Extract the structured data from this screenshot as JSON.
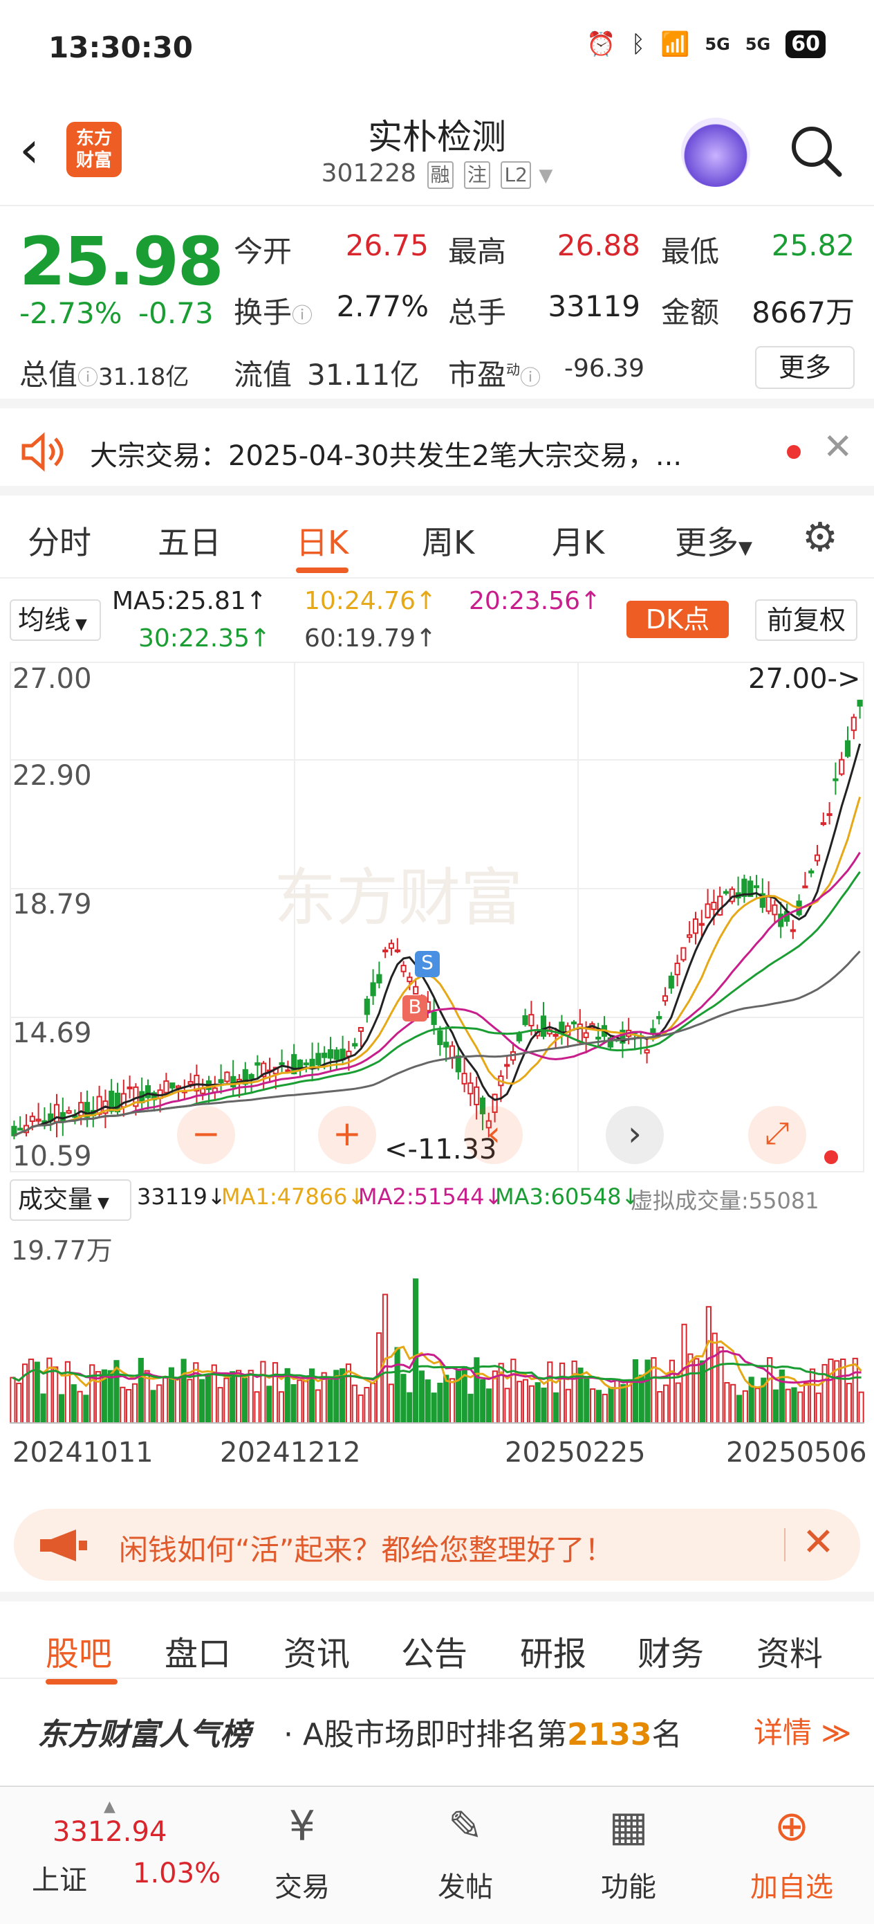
{
  "status": {
    "time": "13:30:30",
    "battery": "60",
    "net1": "5G",
    "net2": "5G"
  },
  "header": {
    "title": "实朴检测",
    "code": "301228",
    "tags": [
      "融",
      "注",
      "L2"
    ],
    "logo": "东方\n财富"
  },
  "quote": {
    "price": "25.98",
    "pct": "-2.73%",
    "chg": "-0.73",
    "open_l": "今开",
    "open_v": "26.75",
    "high_l": "最高",
    "high_v": "26.88",
    "low_l": "最低",
    "low_v": "25.82",
    "turn_l": "换手",
    "turn_v": "2.77%",
    "vol_l": "总手",
    "vol_v": "33119",
    "amt_l": "金额",
    "amt_v": "8667万",
    "cap_l": "总值",
    "cap_v": "31.18亿",
    "fcap_l": "流值",
    "fcap_v": "31.11亿",
    "pe_l": "市盈",
    "pe_v": "-96.39",
    "more": "更多"
  },
  "notice": {
    "text": "大宗交易：2025-04-30共发生2笔大宗交易，..."
  },
  "tabs": [
    "分时",
    "五日",
    "日K",
    "周K",
    "月K",
    "更多"
  ],
  "ma": {
    "sel": "均线",
    "ma5": "MA5:25.81↑",
    "ma10": "10:24.76↑",
    "ma20": "20:23.56↑",
    "ma30": "30:22.35↑",
    "ma60": "60:19.79↑",
    "dk": "DK点",
    "fq": "前复权"
  },
  "chart": {
    "y_labels": [
      "27.00",
      "22.90",
      "18.79",
      "14.69",
      "10.59"
    ],
    "max_label": "27.00->",
    "min_label": "<-11.33"
  },
  "volume": {
    "sel": "成交量",
    "cur": "33119↓",
    "ma1": "MA1:47866↓",
    "ma2": "MA2:51544↓",
    "ma3": "MA3:60548↓",
    "virt": "虚拟成交量:55081",
    "ymax": "19.77万"
  },
  "dates": [
    "20241011",
    "20241212",
    "20250225",
    "20250506"
  ],
  "ad": {
    "text": "闲钱如何“活”起来？都给您整理好了！"
  },
  "subtabs": [
    "股吧",
    "盘口",
    "资讯",
    "公告",
    "研报",
    "财务",
    "资料"
  ],
  "rank": {
    "brand": "东方财富人气榜",
    "text": "· A股市场即时排名第",
    "num": "2133",
    "suffix": "名",
    "detail": "详情"
  },
  "nav": {
    "index_val": "3312.94",
    "index_name": "上证",
    "index_pct": "1.03%",
    "trade": "交易",
    "post": "发帖",
    "func": "功能",
    "add": "加自选"
  },
  "colors": {
    "accent": "#ee5d23",
    "up": "#d9262d",
    "down": "#1a9d33"
  }
}
